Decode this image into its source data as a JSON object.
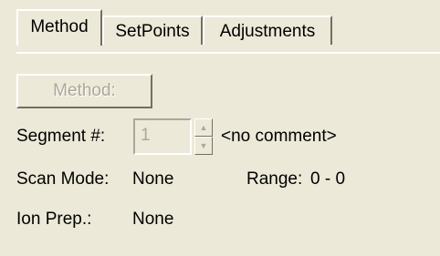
{
  "tabs": [
    {
      "label": "Method",
      "active": true
    },
    {
      "label": "SetPoints",
      "active": false
    },
    {
      "label": "Adjustments",
      "active": false
    }
  ],
  "method_button": {
    "label": "Method:"
  },
  "segment": {
    "label": "Segment #:",
    "value": "1",
    "comment": "<no comment>",
    "up_glyph": "▲",
    "down_glyph": "▼"
  },
  "scan_mode": {
    "label": "Scan Mode:",
    "value": "None"
  },
  "range": {
    "label": "Range:",
    "value": "0 - 0"
  },
  "ion_prep": {
    "label": "Ion Prep.:",
    "value": "None"
  },
  "colors": {
    "background": "#ECE9D8",
    "disabled_text": "#ACA899",
    "highlight": "#FFFFFF",
    "shadow": "#716F64"
  },
  "icons": [
    "spin-up-icon",
    "spin-down-icon"
  ]
}
